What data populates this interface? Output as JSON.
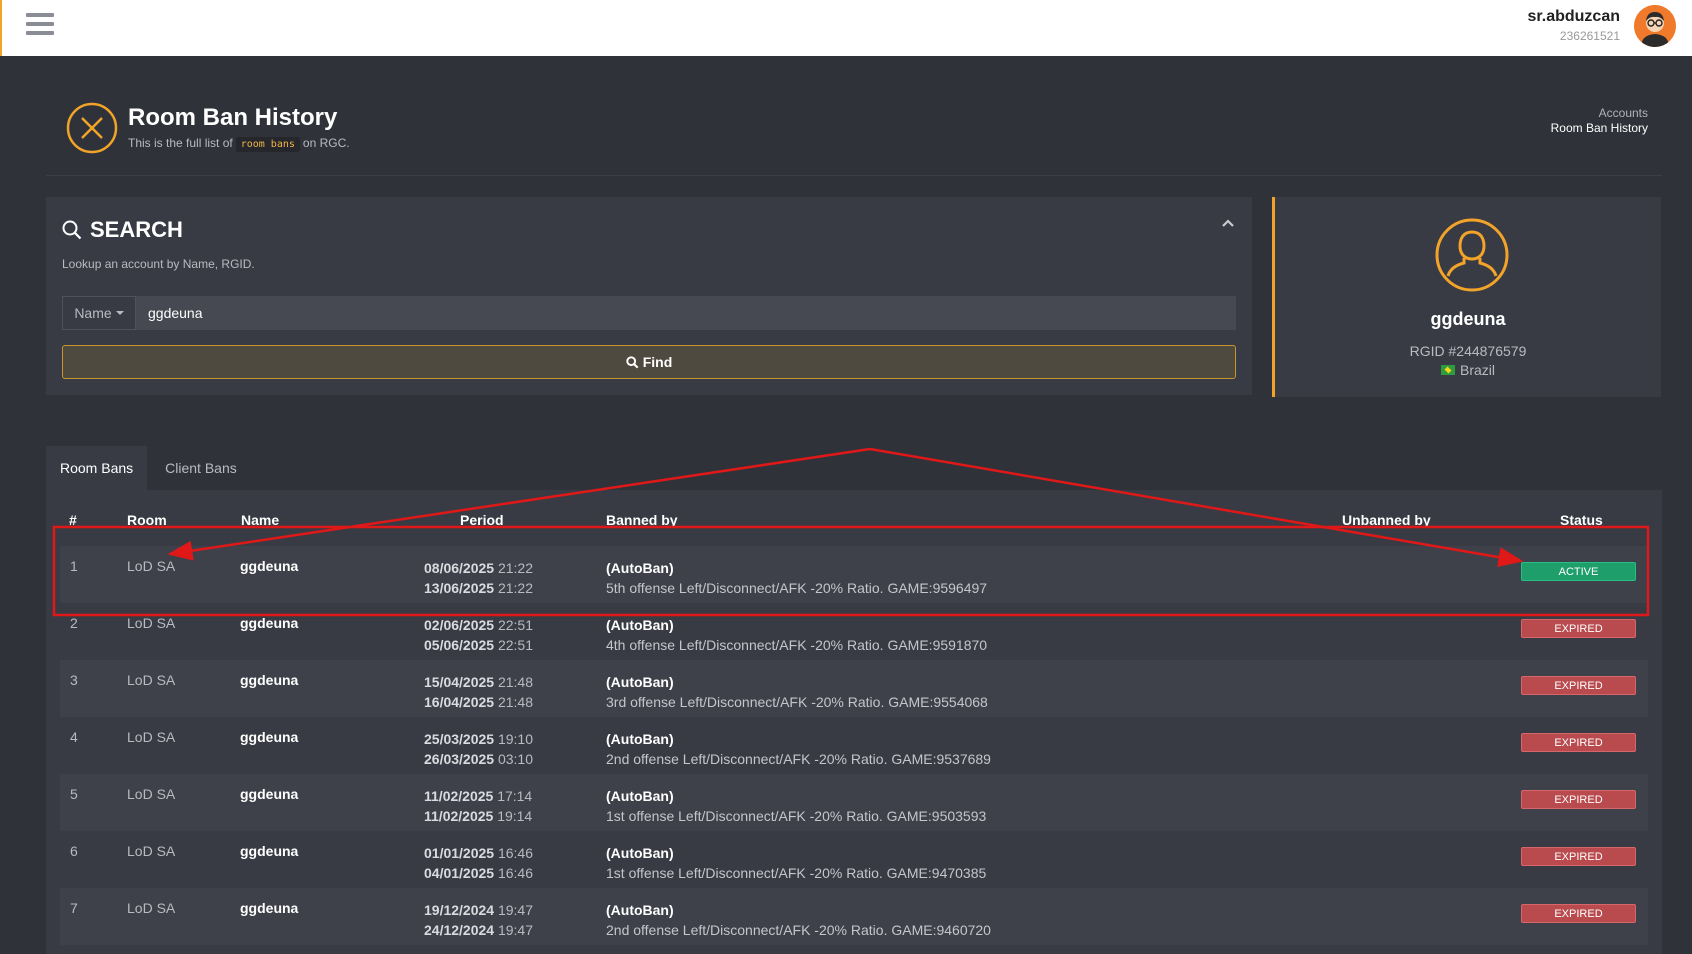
{
  "user": {
    "name": "sr.abduzcan",
    "id": "236261521"
  },
  "header": {
    "title": "Room Ban History",
    "subtitle_prefix": "This is the full list of",
    "subtitle_code": "room bans",
    "subtitle_suffix": "on RGC.",
    "breadcrumb": [
      "Accounts",
      "Room Ban History"
    ]
  },
  "search": {
    "title": "SEARCH",
    "hint": "Lookup an account by Name, RGID.",
    "select_label": "Name",
    "input_value": "ggdeuna",
    "find_label": "Find"
  },
  "profile": {
    "name": "ggdeuna",
    "rgid": "RGID #244876579",
    "country": "Brazil"
  },
  "tabs": [
    "Room Bans",
    "Client Bans"
  ],
  "table": {
    "headers": [
      "#",
      "Room",
      "Name",
      "Period",
      "Banned by",
      "Unbanned by",
      "Status"
    ],
    "rows": [
      {
        "num": "1",
        "room": "LoD SA",
        "name": "ggdeuna",
        "start_date": "08/06/2025",
        "start_time": "21:22",
        "end_date": "13/06/2025",
        "end_time": "21:22",
        "banned_by": "(AutoBan)",
        "reason": "5th offense Left/Disconnect/AFK -20% Ratio. GAME:9596497",
        "unbanned_by": "",
        "status": "ACTIVE"
      },
      {
        "num": "2",
        "room": "LoD SA",
        "name": "ggdeuna",
        "start_date": "02/06/2025",
        "start_time": "22:51",
        "end_date": "05/06/2025",
        "end_time": "22:51",
        "banned_by": "(AutoBan)",
        "reason": "4th offense Left/Disconnect/AFK -20% Ratio. GAME:9591870",
        "unbanned_by": "",
        "status": "EXPIRED"
      },
      {
        "num": "3",
        "room": "LoD SA",
        "name": "ggdeuna",
        "start_date": "15/04/2025",
        "start_time": "21:48",
        "end_date": "16/04/2025",
        "end_time": "21:48",
        "banned_by": "(AutoBan)",
        "reason": "3rd offense Left/Disconnect/AFK -20% Ratio. GAME:9554068",
        "unbanned_by": "",
        "status": "EXPIRED"
      },
      {
        "num": "4",
        "room": "LoD SA",
        "name": "ggdeuna",
        "start_date": "25/03/2025",
        "start_time": "19:10",
        "end_date": "26/03/2025",
        "end_time": "03:10",
        "banned_by": "(AutoBan)",
        "reason": "2nd offense Left/Disconnect/AFK -20% Ratio. GAME:9537689",
        "unbanned_by": "",
        "status": "EXPIRED"
      },
      {
        "num": "5",
        "room": "LoD SA",
        "name": "ggdeuna",
        "start_date": "11/02/2025",
        "start_time": "17:14",
        "end_date": "11/02/2025",
        "end_time": "19:14",
        "banned_by": "(AutoBan)",
        "reason": "1st offense Left/Disconnect/AFK -20% Ratio. GAME:9503593",
        "unbanned_by": "",
        "status": "EXPIRED"
      },
      {
        "num": "6",
        "room": "LoD SA",
        "name": "ggdeuna",
        "start_date": "01/01/2025",
        "start_time": "16:46",
        "end_date": "04/01/2025",
        "end_time": "16:46",
        "banned_by": "(AutoBan)",
        "reason": "1st offense Left/Disconnect/AFK -20% Ratio. GAME:9470385",
        "unbanned_by": "",
        "status": "EXPIRED"
      },
      {
        "num": "7",
        "room": "LoD SA",
        "name": "ggdeuna",
        "start_date": "19/12/2024",
        "start_time": "19:47",
        "end_date": "24/12/2024",
        "end_time": "19:47",
        "banned_by": "(AutoBan)",
        "reason": "2nd offense Left/Disconnect/AFK -20% Ratio. GAME:9460720",
        "unbanned_by": "",
        "status": "EXPIRED"
      }
    ]
  },
  "colors": {
    "accent": "#f2a32a",
    "active": "#1e9e6a",
    "expired": "#b94a4e",
    "annotation": "#e01818"
  },
  "icons": {
    "menu": "hamburger-icon",
    "search": "search-icon",
    "find": "search-icon",
    "collapse": "chevron-up-icon",
    "header": "close-circle-icon",
    "profile": "user-silhouette-icon"
  }
}
